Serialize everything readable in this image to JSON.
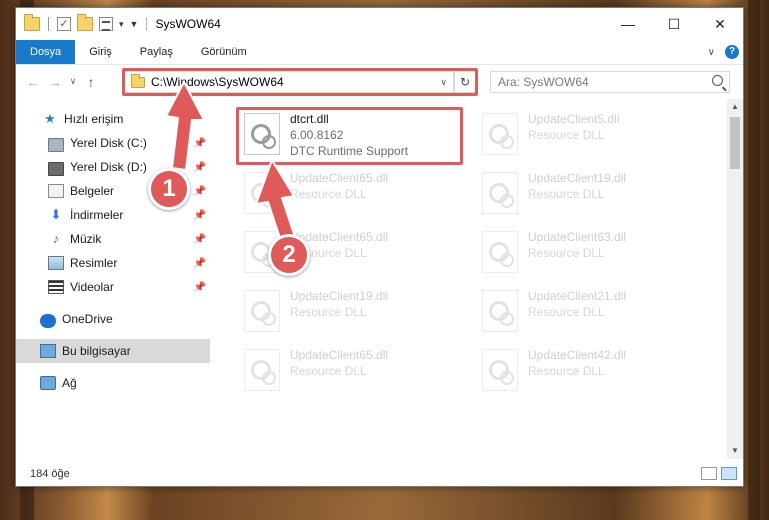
{
  "window": {
    "title": "SysWOW64"
  },
  "ribbon": {
    "tabs": [
      {
        "label": "Dosya"
      },
      {
        "label": "Giriş"
      },
      {
        "label": "Paylaş"
      },
      {
        "label": "Görünüm"
      }
    ]
  },
  "address": {
    "path": "C:\\Windows\\SysWOW64",
    "search_placeholder": "Ara: SysWOW64"
  },
  "nav": {
    "items": [
      {
        "label": "Hızlı erişim",
        "icon": "star-icon"
      },
      {
        "label": "Yerel Disk (C:)",
        "icon": "drive-icon"
      },
      {
        "label": "Yerel Disk (D:)",
        "icon": "drive-icon"
      },
      {
        "label": "Belgeler",
        "icon": "documents-icon"
      },
      {
        "label": "İndirmeler",
        "icon": "download-icon"
      },
      {
        "label": "Müzik",
        "icon": "music-icon"
      },
      {
        "label": "Resimler",
        "icon": "pictures-icon"
      },
      {
        "label": "Videolar",
        "icon": "videos-icon"
      },
      {
        "label": "OneDrive",
        "icon": "cloud-icon"
      },
      {
        "label": "Bu bilgisayar",
        "icon": "computer-icon"
      },
      {
        "label": "Ağ",
        "icon": "network-icon"
      }
    ]
  },
  "files": [
    {
      "name": "dtcrt.dll",
      "line2": "6.00.8162",
      "line3": "DTC Runtime Support"
    },
    {
      "name": "UpdateClient5.dll",
      "line2": "Resource DLL"
    },
    {
      "name": "UpdateClient65.dll",
      "line2": "Resource DLL"
    },
    {
      "name": "UpdateClient19.dll",
      "line2": "Resource DLL"
    },
    {
      "name": "UpdateClient65.dll",
      "line2": "Resource DLL"
    },
    {
      "name": "UpdateClient63.dll",
      "line2": "Resource DLL"
    },
    {
      "name": "UpdateClient19.dll",
      "line2": "Resource DLL"
    },
    {
      "name": "UpdateClient21.dll",
      "line2": "Resource DLL"
    },
    {
      "name": "UpdateClient65.dll",
      "line2": "Resource DLL"
    },
    {
      "name": "UpdateClient42.dll",
      "line2": "Resource DLL"
    }
  ],
  "status": {
    "count": "184 öğe"
  },
  "annotations": {
    "badge1": "1",
    "badge2": "2",
    "color": "#e05a5a"
  }
}
